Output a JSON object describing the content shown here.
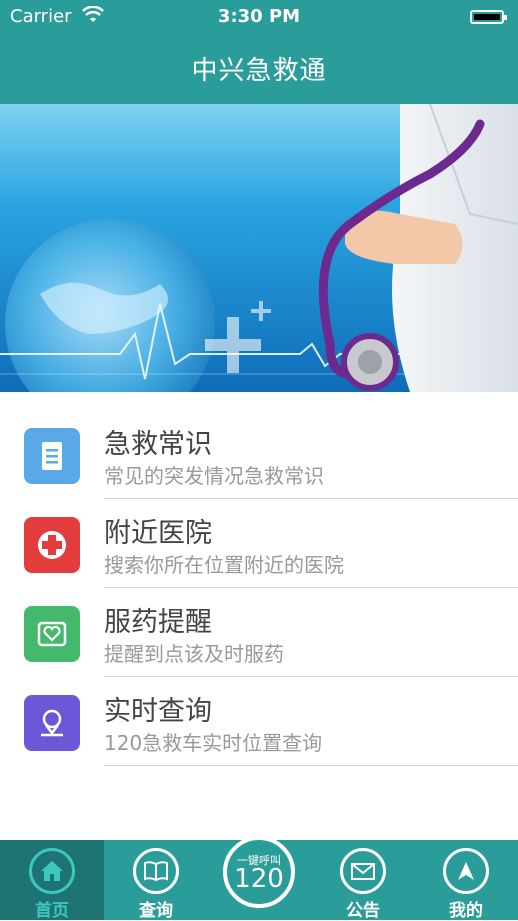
{
  "status_bar": {
    "carrier": "Carrier",
    "time": "3:30 PM"
  },
  "header": {
    "title": "中兴急救通"
  },
  "menu": [
    {
      "title": "急救常识",
      "subtitle": "常见的突发情况急救常识",
      "icon": "document-list-icon",
      "color": "#5aa9e6"
    },
    {
      "title": "附近医院",
      "subtitle": "搜索你所在位置附近的医院",
      "icon": "red-cross-icon",
      "color": "#e23c3c"
    },
    {
      "title": "服药提醒",
      "subtitle": "提醒到点该及时服药",
      "icon": "pill-reminder-icon",
      "color": "#44b86b"
    },
    {
      "title": "实时查询",
      "subtitle": "120急救车实时位置查询",
      "icon": "location-pin-icon",
      "color": "#6b57d8"
    }
  ],
  "tabbar": {
    "tabs": [
      {
        "label": "首页",
        "icon": "home-icon",
        "active": true
      },
      {
        "label": "查询",
        "icon": "book-icon",
        "active": false
      },
      {
        "label": "",
        "icon": "call-120-icon",
        "active": false
      },
      {
        "label": "公告",
        "icon": "mail-icon",
        "active": false
      },
      {
        "label": "我的",
        "icon": "navigation-arrow-icon",
        "active": false
      }
    ],
    "call_button": {
      "top_text": "一键呼叫",
      "number": "120"
    }
  }
}
